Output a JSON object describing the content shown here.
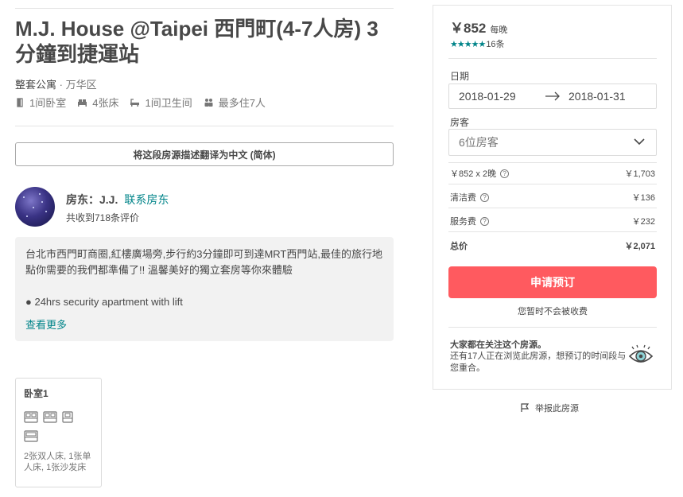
{
  "listing": {
    "title": "M.J. House @Taipei 西門町(4-7人房) 3分鐘到捷運站",
    "type": "整套公寓",
    "separator": " · ",
    "district": "万华区",
    "amenities": {
      "bedrooms": "1间卧室",
      "beds": "4张床",
      "bathrooms": "1间卫生间",
      "guests": "最多住7人"
    },
    "translate_button": "将这段房源描述翻译为中文 (简体)"
  },
  "host": {
    "prefix": "房东：",
    "name": "J.J.",
    "contact": "联系房东",
    "reviews": "共收到718条评价"
  },
  "description": {
    "text": "台北市西門町商圈,紅樓廣場旁,步行約3分鐘即可到達MRT西門站,最佳的旅行地點你需要的我們都準備了!! 溫馨美好的獨立套房等你來體驗",
    "bullet": "● 24hrs security apartment with lift",
    "more": "查看更多"
  },
  "bedroom": {
    "title": "卧室1",
    "beds_text": "2张双人床, 1张单人床, 1张沙发床"
  },
  "booking": {
    "price": "￥852",
    "per_night": "每晚",
    "stars": "★★★★★",
    "rating_stars": 5,
    "review_count": "16条",
    "dates_label": "日期",
    "check_in": "2018-01-29",
    "check_out": "2018-01-31",
    "guests_label": "房客",
    "guests_value": "6位房客",
    "nights_label": "￥852 x 2晚",
    "nights_amount": "￥1,703",
    "cleaning_label": "清洁费",
    "cleaning_amount": "￥136",
    "service_label": "服务费",
    "service_amount": "￥232",
    "total_label": "总价",
    "total_amount": "￥2,071",
    "book_button": "申请预订",
    "no_charge": "您暂时不会被收费",
    "notice_title": "大家都在关注这个房源。",
    "notice_text": "还有17人正在浏览此房源，想预订的时间段与您重合。",
    "help_mark": "?"
  },
  "report": "举报此房源",
  "colors": {
    "accent": "#008489",
    "book_button": "#ff5a5f",
    "text": "#484848",
    "muted": "#767676"
  }
}
